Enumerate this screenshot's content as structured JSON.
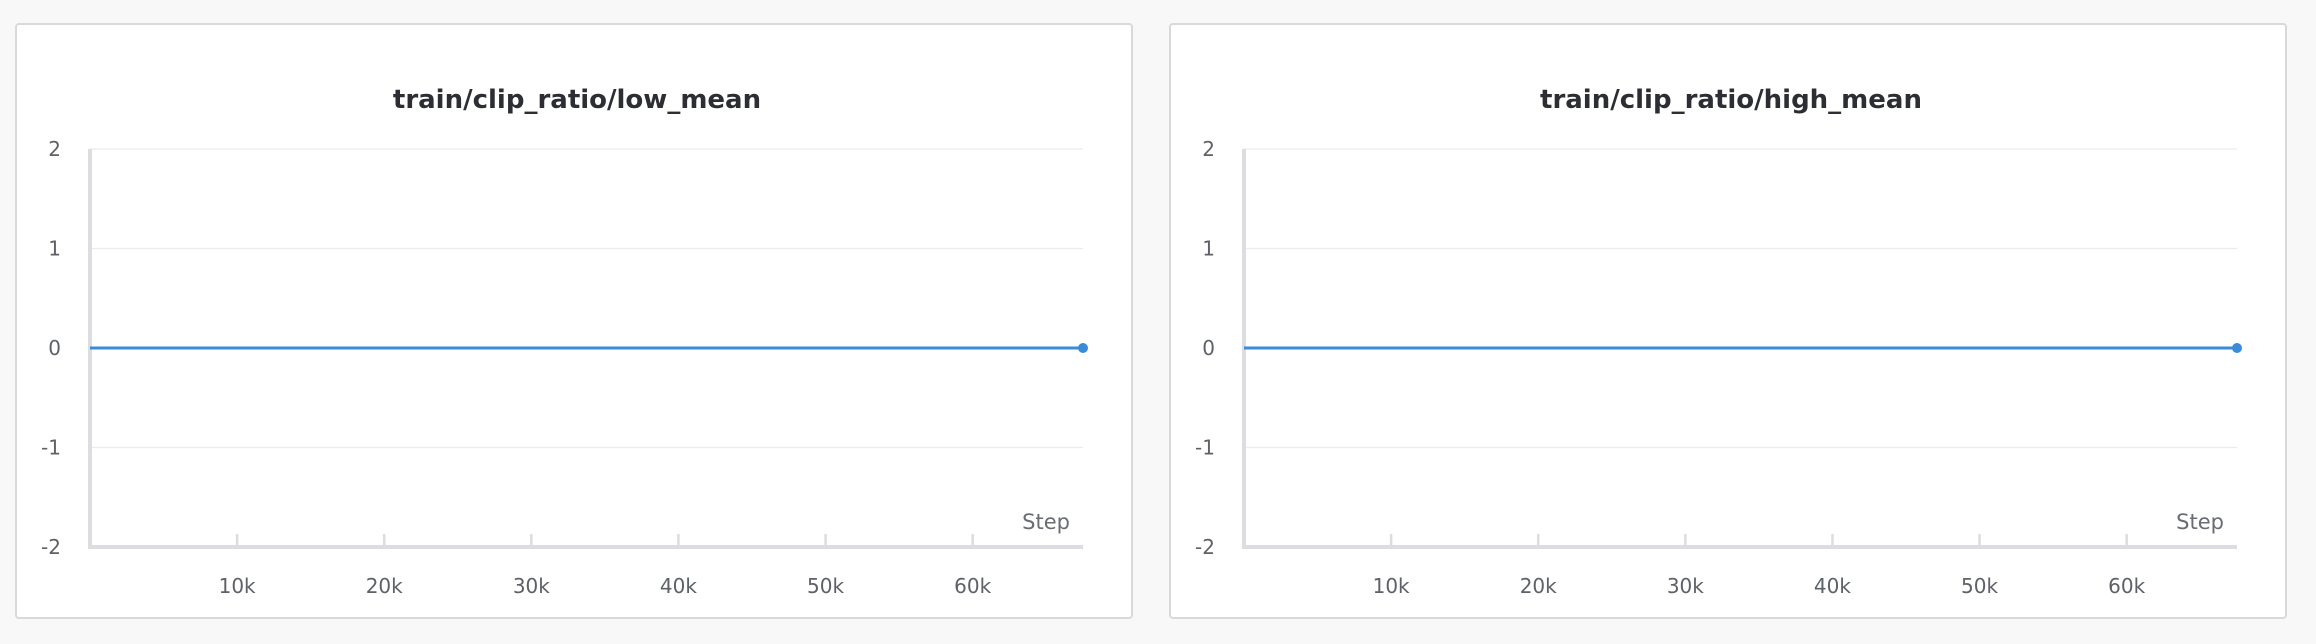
{
  "chart_data": [
    {
      "type": "line",
      "title": "train/clip_ratio/low_mean",
      "xlabel": "Step",
      "ylabel": "",
      "xlim": [
        0,
        67500
      ],
      "ylim": [
        -2,
        2
      ],
      "x_ticks": [
        "10k",
        "20k",
        "30k",
        "40k",
        "50k",
        "60k"
      ],
      "x_tick_values": [
        10000,
        20000,
        30000,
        40000,
        50000,
        60000
      ],
      "y_ticks": [
        "2",
        "1",
        "0",
        "-1",
        "-2"
      ],
      "y_tick_values": [
        2,
        1,
        0,
        -1,
        -2
      ],
      "grid": true,
      "series": [
        {
          "color": "#3a8bd8",
          "x": [
            0,
            67500
          ],
          "y": [
            0,
            0
          ]
        }
      ]
    },
    {
      "type": "line",
      "title": "train/clip_ratio/high_mean",
      "xlabel": "Step",
      "ylabel": "",
      "xlim": [
        0,
        67500
      ],
      "ylim": [
        -2,
        2
      ],
      "x_ticks": [
        "10k",
        "20k",
        "30k",
        "40k",
        "50k",
        "60k"
      ],
      "x_tick_values": [
        10000,
        20000,
        30000,
        40000,
        50000,
        60000
      ],
      "y_ticks": [
        "2",
        "1",
        "0",
        "-1",
        "-2"
      ],
      "y_tick_values": [
        2,
        1,
        0,
        -1,
        -2
      ],
      "grid": true,
      "series": [
        {
          "color": "#3a8bd8",
          "x": [
            0,
            67500
          ],
          "y": [
            0,
            0
          ]
        }
      ]
    }
  ]
}
